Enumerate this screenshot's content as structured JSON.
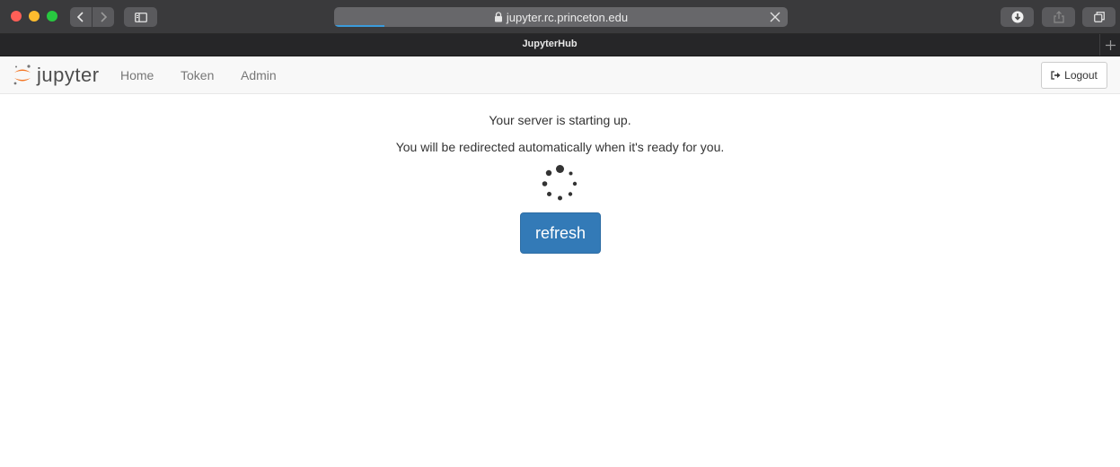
{
  "browser": {
    "url": "jupyter.rc.princeton.edu",
    "tab_title": "JupyterHub",
    "load_progress": 0.11
  },
  "header": {
    "logo_text": "jupyter",
    "nav": [
      {
        "label": "Home"
      },
      {
        "label": "Token"
      },
      {
        "label": "Admin"
      }
    ],
    "logout_label": "Logout"
  },
  "main": {
    "message1": "Your server is starting up.",
    "message2": "You will be redirected automatically when it's ready for you.",
    "refresh_label": "refresh"
  },
  "colors": {
    "accent": "#337ab7",
    "jupyter_orange": "#f37726"
  },
  "icons": [
    "back-icon",
    "forward-icon",
    "sidebar-icon",
    "lock-icon",
    "close-icon",
    "download-icon",
    "share-icon",
    "tabs-icon",
    "new-tab-icon",
    "jupyter-logo-icon",
    "logout-icon",
    "spinner-icon"
  ]
}
